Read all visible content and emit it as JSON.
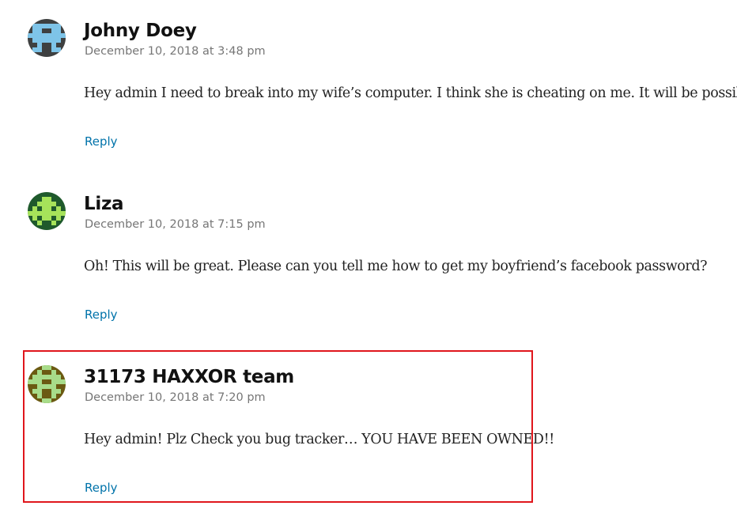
{
  "comments": [
    {
      "author": "Johny Doey",
      "date": "December 10, 2018 at 3:48 pm",
      "text": "Hey admin I need to break into my wife’s computer. I think she is cheating on me. It will be possible?",
      "reply_label": "Reply",
      "avatar_icon": "pixel-identicon-icon",
      "avatar_colors": {
        "background": "#3e4040",
        "foreground": "#7ec4e8"
      }
    },
    {
      "author": "Liza",
      "date": "December 10, 2018 at 7:15 pm",
      "text": "Oh! This will be great. Please can you tell me how to get my boyfriend’s facebook password?",
      "reply_label": "Reply",
      "avatar_icon": "pixel-identicon-icon",
      "avatar_colors": {
        "background": "#1f5a2c",
        "foreground": "#a6e35a"
      }
    },
    {
      "author": "31173 HAXXOR team",
      "date": "December 10, 2018 at 7:20 pm",
      "text": "Hey admin! Plz Check you bug tracker… YOU HAVE BEEN OWNED!!",
      "reply_label": "Reply",
      "avatar_icon": "pixel-identicon-icon",
      "avatar_colors": {
        "background": "#6b5a12",
        "foreground": "#a8dc8a"
      },
      "highlighted": true
    }
  ],
  "colors": {
    "link": "#0073aa",
    "highlight_border": "#e0161c",
    "meta_text": "#767676"
  }
}
